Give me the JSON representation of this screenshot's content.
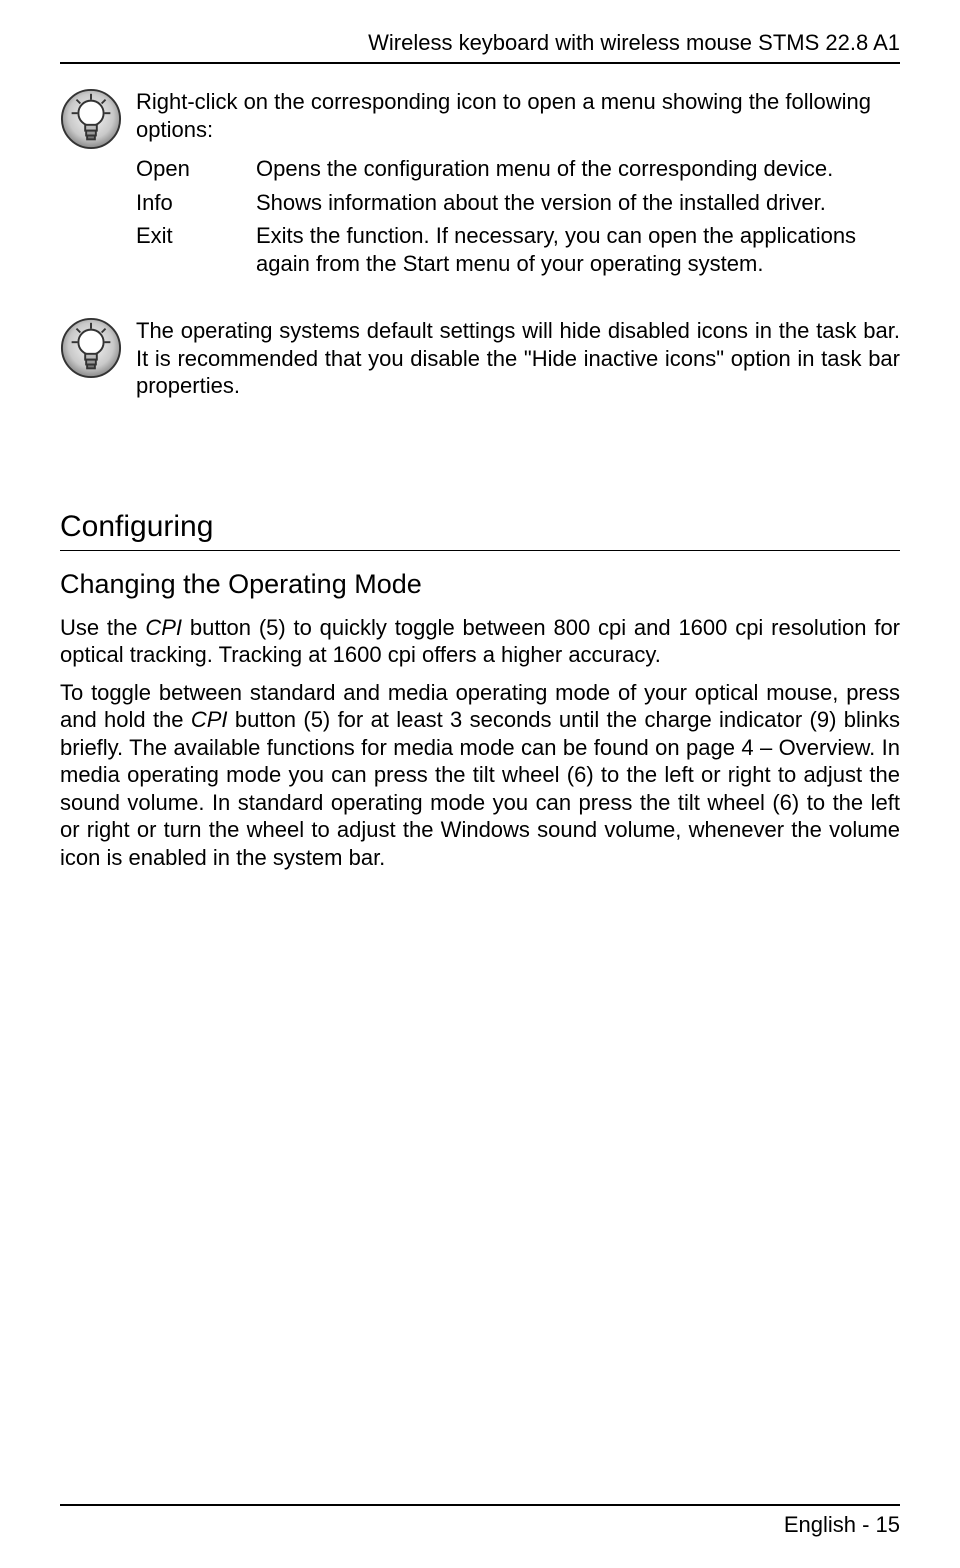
{
  "header": {
    "title": "Wireless keyboard with wireless mouse STMS 22.8 A1"
  },
  "tip1": {
    "intro": "Right-click on the corresponding icon to open a menu showing the following options:",
    "options": [
      {
        "key": "Open",
        "desc": "Opens the configuration menu of the corresponding device."
      },
      {
        "key": "Info",
        "desc": "Shows information about the version of the installed driver."
      },
      {
        "key": "Exit",
        "desc": "Exits the function. If necessary, you can open the applications again from the Start menu of your operating system."
      }
    ]
  },
  "tip2": {
    "text": "The operating systems default settings will hide disabled icons in the task bar. It is recommended that you disable the \"Hide inactive icons\" option in task bar properties."
  },
  "section": {
    "h1": "Configuring",
    "h2": "Changing the Operating Mode",
    "p1_a": "Use the ",
    "p1_cpi": "CPI",
    "p1_b": " button (5) to quickly toggle between 800 cpi and 1600 cpi resolution for optical tracking. Tracking at 1600 cpi offers a higher accuracy.",
    "p2_a": "To toggle between standard and media operating mode of your optical mouse, press and hold the ",
    "p2_cpi": "CPI",
    "p2_b": " button (5) for at least 3 seconds until the charge indicator (9) blinks briefly. The available functions for media mode can be found on page 4 – Overview. In media operating mode you can press the tilt wheel (6) to the left or right to adjust the sound volume. In standard operating mode you can press the tilt wheel (6) to the left or right or turn the wheel to adjust the Windows sound volume, whenever the volume icon is enabled in the system bar."
  },
  "footer": {
    "text": "English  -  15"
  }
}
